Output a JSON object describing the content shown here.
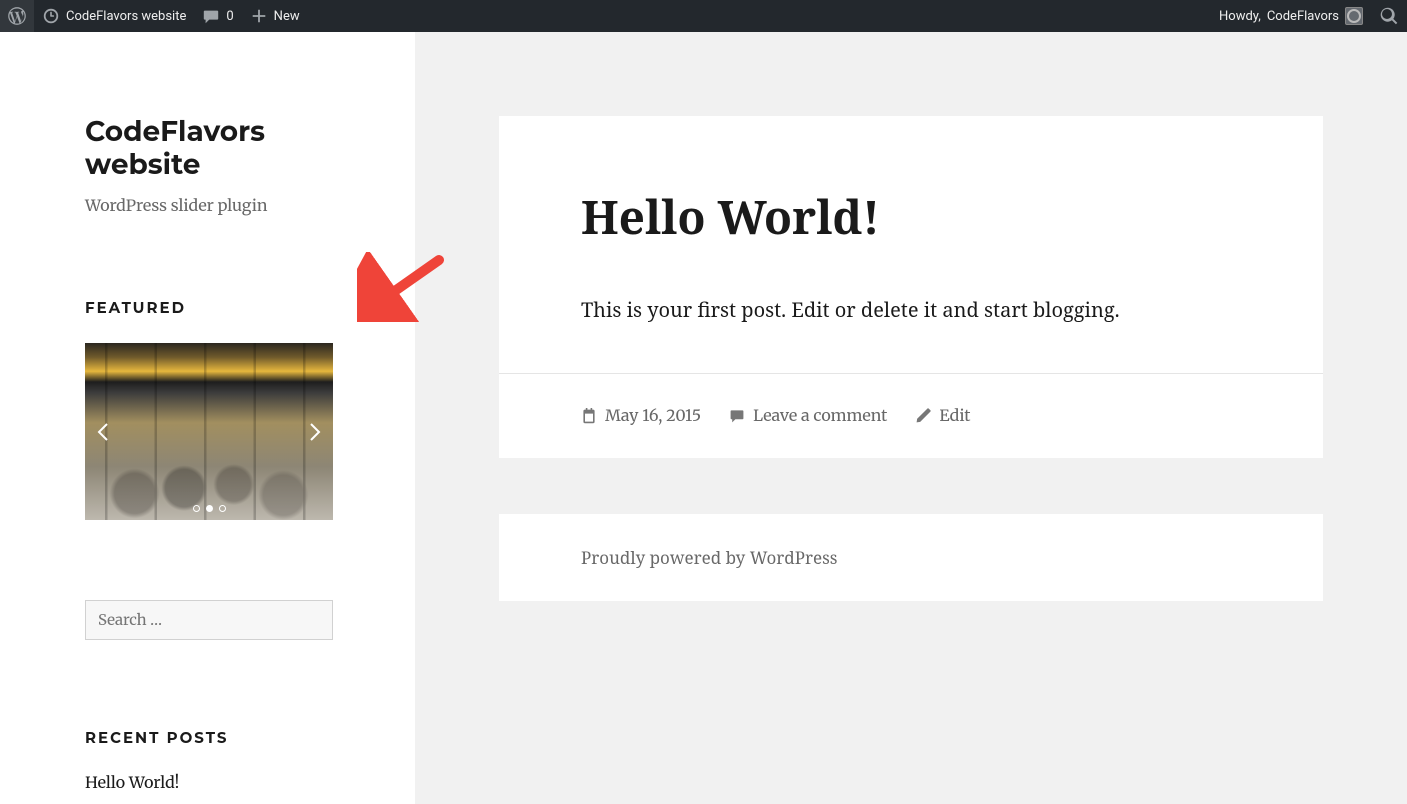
{
  "adminbar": {
    "site_name": "CodeFlavors website",
    "comments_count": "0",
    "new_label": "New",
    "howdy_prefix": "Howdy, ",
    "user_name": "CodeFlavors"
  },
  "sidebar": {
    "site_title": "CodeFlavors website",
    "site_description": "WordPress slider plugin",
    "featured": {
      "heading": "FEATURED",
      "slide_count": 3,
      "active_slide": 2
    },
    "search": {
      "placeholder": "Search …",
      "value": ""
    },
    "recent": {
      "heading": "RECENT POSTS",
      "items": [
        "Hello World!"
      ]
    }
  },
  "post": {
    "title": "Hello World!",
    "content": "This is your first post. Edit or delete it and start blogging.",
    "date": "May 16, 2015",
    "comment_link": "Leave a comment",
    "edit_link": "Edit"
  },
  "footer_credit": "Proudly powered by WordPress"
}
